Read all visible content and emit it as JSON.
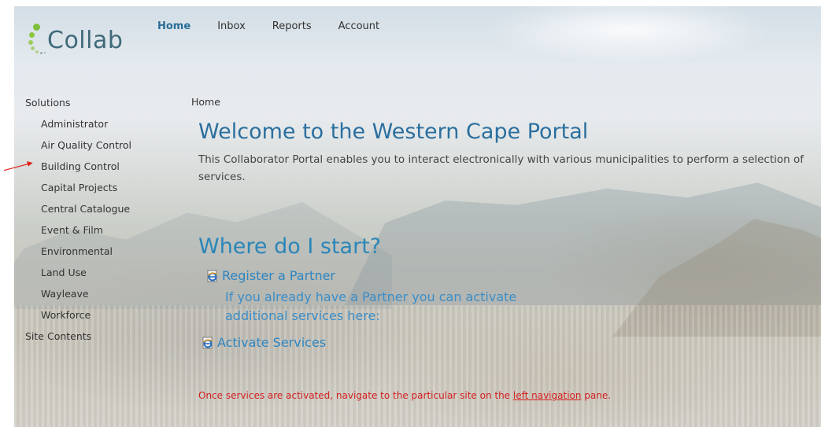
{
  "app": {
    "logo_text": "Collab"
  },
  "topnav": [
    {
      "label": "Home",
      "active": true
    },
    {
      "label": "Inbox",
      "active": false
    },
    {
      "label": "Reports",
      "active": false
    },
    {
      "label": "Account",
      "active": false
    }
  ],
  "sidebar": {
    "solutions_label": "Solutions",
    "items": [
      "Administrator",
      "Air Quality Control",
      "Building Control",
      "Capital Projects",
      "Central Catalogue",
      "Event & Film",
      "Environmental",
      "Land Use",
      "Wayleave",
      "Workforce"
    ],
    "site_contents_label": "Site Contents"
  },
  "breadcrumb": "Home",
  "main": {
    "title": "Welcome to the Western Cape Portal",
    "intro": "This Collaborator Portal enables you to  interact electronically with various municipalities to perform a selection of services.",
    "start_heading": "Where do I start?",
    "register_link": "Register a Partner",
    "existing_partner_line1": "If you already have a Partner you can activate",
    "existing_partner_line2": "additional services here:",
    "activate_link": "Activate Services",
    "notice_before": "Once services are activated, navigate to the particular site on the ",
    "notice_link": "left navigation",
    "notice_after": " pane."
  },
  "colors": {
    "accent_blue": "#2b6f9f",
    "link_blue": "#2e86c1",
    "notice_red": "#d42020",
    "annotation_arrow": "#e0201b"
  },
  "icons": {
    "link_icon": "ie-page-icon",
    "annotation": "red-arrow-pointer"
  }
}
